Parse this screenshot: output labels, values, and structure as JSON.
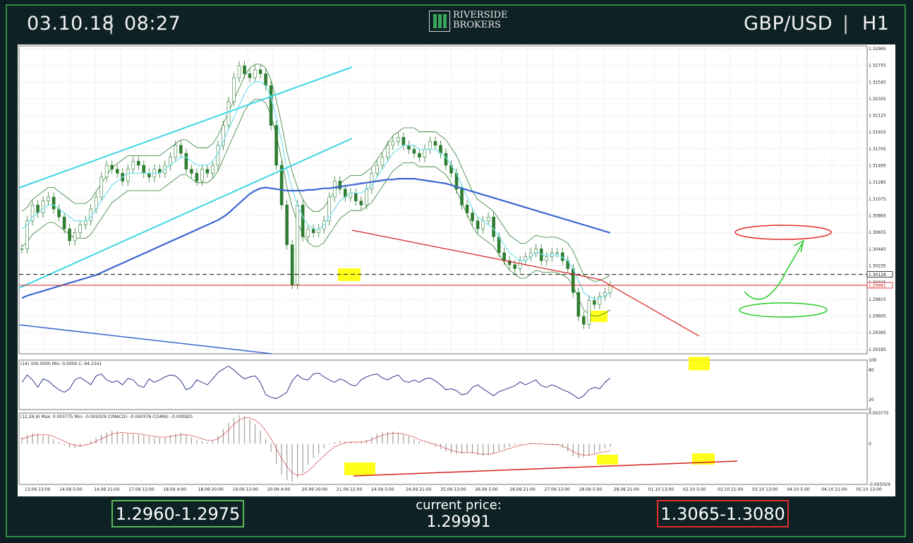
{
  "header": {
    "date": "03.10.18",
    "separator": "|",
    "time": "08:27",
    "pair": "GBP/USD",
    "timeframe": "H1"
  },
  "logo": {
    "line1": "RIVERSIDE",
    "line2": "BROKERS"
  },
  "footer": {
    "support_range": "1.2960-1.2975",
    "current_price_label": "current price:",
    "current_price": "1.29991",
    "resistance_range": "1.3065-1.3080"
  },
  "colors": {
    "background": "#0e2124",
    "frame": "#2f8a45",
    "support_box": "#5cb85c",
    "resistance_box": "#e52b2b",
    "price_candles": "#2e7d32",
    "bollinger": "#2e7d32",
    "ma_fast": "#7fe3ee",
    "ma_slow": "#3a66d0",
    "channel": "#3fd6e6",
    "trendline": "#d62020",
    "highlight": "#ffff00",
    "rsi_line": "#1a237e",
    "macd_hist": "#9e9e9e",
    "macd_signal": "#c62828"
  },
  "chart_data": {
    "type": "line",
    "main": {
      "y_ticks": [
        "1.32965",
        "1.32755",
        "1.32545",
        "1.32335",
        "1.32125",
        "1.31915",
        "1.31705",
        "1.31495",
        "1.31285",
        "1.31075",
        "1.30865",
        "1.30655",
        "1.30445",
        "1.30235",
        "1.30025",
        "1.29815",
        "1.29605",
        "1.29395",
        "1.29185"
      ],
      "y_range": [
        1.2913,
        1.33
      ],
      "marked_levels": [
        {
          "label": "1.30128",
          "value": 1.30128,
          "style": "dashed black"
        },
        {
          "label": "1.29991",
          "value": 1.29991,
          "style": "solid red"
        }
      ],
      "series": [
        {
          "values": [
            1.3045,
            1.308,
            1.31,
            1.309,
            1.3105,
            1.311,
            1.3095,
            1.3085,
            1.307,
            1.3055,
            1.3065,
            1.3075,
            1.308,
            1.3095,
            1.311,
            1.3135,
            1.315,
            1.3145,
            1.314,
            1.313,
            1.3145,
            1.3155,
            1.315,
            1.314,
            1.3135,
            1.3145,
            1.314,
            1.315,
            1.316,
            1.3175,
            1.3165,
            1.3145,
            1.314,
            1.313,
            1.3145,
            1.314,
            1.315,
            1.3175,
            1.32,
            1.323,
            1.326,
            1.3275,
            1.3265,
            1.326,
            1.327,
            1.3265,
            1.325,
            1.32,
            1.315,
            1.31,
            1.305,
            1.3,
            1.31,
            1.306,
            1.307,
            1.3065,
            1.307,
            1.308,
            1.311,
            1.313,
            1.312,
            1.311,
            1.3115,
            1.3105,
            1.31,
            1.312,
            1.314,
            1.315,
            1.316,
            1.3175,
            1.318,
            1.3185,
            1.3175,
            1.317,
            1.3165,
            1.316,
            1.317,
            1.318,
            1.3175,
            1.3165,
            1.315,
            1.314,
            1.312,
            1.31,
            1.309,
            1.308,
            1.307,
            1.308,
            1.3085,
            1.306,
            1.304,
            1.303,
            1.3025,
            1.302,
            1.303,
            1.3035,
            1.304,
            1.3045,
            1.303,
            1.3035,
            1.304,
            1.304,
            1.303,
            1.302,
            1.299,
            1.296,
            1.295,
            1.298,
            1.2975,
            1.2985,
            1.299,
            1.2999
          ]
        },
        {
          "values": [
            1.307,
            1.3075,
            1.3085,
            1.309,
            1.3095,
            1.31,
            1.31,
            1.3095,
            1.309,
            1.3085,
            1.308,
            1.308,
            1.308,
            1.3085,
            1.3095,
            1.3105,
            1.3115,
            1.3125,
            1.313,
            1.3135,
            1.314,
            1.314,
            1.314,
            1.314,
            1.314,
            1.314,
            1.314,
            1.3145,
            1.315,
            1.3155,
            1.316,
            1.316,
            1.3155,
            1.315,
            1.315,
            1.315,
            1.3155,
            1.3165,
            1.318,
            1.3195,
            1.321,
            1.3225,
            1.324,
            1.325,
            1.3255,
            1.3255,
            1.325,
            1.3235,
            1.321,
            1.318,
            1.3145,
            1.312,
            1.31,
            1.3085,
            1.3075,
            1.307,
            1.307,
            1.3075,
            1.3085,
            1.3095,
            1.3105,
            1.311,
            1.3115,
            1.3115,
            1.3115,
            1.312,
            1.3125,
            1.3135,
            1.3145,
            1.3155,
            1.3165,
            1.317,
            1.3175,
            1.3175,
            1.3175,
            1.317,
            1.317,
            1.317,
            1.317,
            1.3165,
            1.316,
            1.315,
            1.314,
            1.3125,
            1.311,
            1.3095,
            1.3085,
            1.308,
            1.3075,
            1.307,
            1.306,
            1.305,
            1.304,
            1.3035,
            1.303,
            1.303,
            1.3035,
            1.304,
            1.3038,
            1.3037,
            1.3038,
            1.3037,
            1.3034,
            1.303,
            1.302,
            1.3005,
            1.299,
            1.2985,
            1.2982,
            1.2983,
            1.2986,
            1.299
          ]
        },
        {
          "values": [
            1.2983,
            1.2986,
            1.2988,
            1.299,
            1.2992,
            1.2994,
            1.2996,
            1.2998,
            1.3,
            1.3002,
            1.3004,
            1.3006,
            1.3008,
            1.301,
            1.3012,
            1.3015,
            1.3018,
            1.3021,
            1.3024,
            1.3027,
            1.303,
            1.3033,
            1.3036,
            1.3039,
            1.3042,
            1.3045,
            1.3048,
            1.3051,
            1.3054,
            1.3057,
            1.306,
            1.3063,
            1.3066,
            1.3069,
            1.3072,
            1.3075,
            1.3078,
            1.3081,
            1.3085,
            1.309,
            1.3096,
            1.3102,
            1.3108,
            1.3114,
            1.3118,
            1.3121,
            1.3122,
            1.3121,
            1.312,
            1.3119,
            1.3118,
            1.3118,
            1.3118,
            1.3118,
            1.3119,
            1.3119,
            1.312,
            1.3121,
            1.3121,
            1.3122,
            1.3123,
            1.3124,
            1.3125,
            1.3126,
            1.3127,
            1.3128,
            1.3129,
            1.313,
            1.3131,
            1.3132,
            1.3132,
            1.3133,
            1.3133,
            1.3133,
            1.3133,
            1.3132,
            1.3131,
            1.313,
            1.3129,
            1.3128,
            1.3127,
            1.3125,
            1.3123,
            1.3121,
            1.3119,
            1.3117,
            1.3115,
            1.3113,
            1.3111,
            1.3109,
            1.3107,
            1.3105,
            1.3103,
            1.3101,
            1.3099,
            1.3097,
            1.3095,
            1.3093,
            1.3091,
            1.3089,
            1.3087,
            1.3085,
            1.3083,
            1.3081,
            1.3079,
            1.3077,
            1.3075,
            1.3073,
            1.3071,
            1.3069,
            1.3067,
            1.3065
          ]
        }
      ]
    },
    "rsi": {
      "header": "(14) 100.0000 Min: 0.0000 C: 64.1541",
      "y_ticks": [
        "100",
        "80",
        "20",
        "0"
      ],
      "y_range": [
        0,
        100
      ],
      "values": [
        55,
        70,
        60,
        45,
        62,
        58,
        48,
        40,
        35,
        42,
        60,
        65,
        58,
        50,
        68,
        72,
        60,
        55,
        58,
        50,
        63,
        60,
        48,
        45,
        62,
        55,
        60,
        66,
        70,
        68,
        58,
        40,
        45,
        60,
        55,
        50,
        62,
        75,
        82,
        88,
        80,
        70,
        62,
        66,
        68,
        55,
        30,
        25,
        22,
        28,
        35,
        58,
        70,
        62,
        60,
        72,
        74,
        66,
        60,
        55,
        62,
        58,
        50,
        48,
        60,
        66,
        70,
        72,
        64,
        60,
        66,
        70,
        58,
        55,
        60,
        55,
        62,
        64,
        58,
        50,
        40,
        42,
        38,
        30,
        32,
        45,
        50,
        42,
        35,
        28,
        36,
        40,
        44,
        48,
        56,
        50,
        55,
        60,
        48,
        45,
        50,
        46,
        40,
        36,
        30,
        22,
        28,
        40,
        45,
        42,
        55,
        64
      ]
    },
    "macd": {
      "header": "(12,26,9) Max: 0.003775 Min: -0.005029 C(MACD): -0.000376 C(SMA): -0.000920",
      "y_ticks": [
        "0.003775",
        "0",
        "-0.005029"
      ],
      "y_range": [
        -0.005029,
        0.003775
      ],
      "histogram": [
        0.0008,
        0.0011,
        0.0013,
        0.0012,
        0.0011,
        0.001,
        0.0006,
        0.0002,
        -0.0002,
        -0.0005,
        -0.0006,
        -0.0004,
        -0.0001,
        0.0003,
        0.0007,
        0.0011,
        0.0014,
        0.0016,
        0.0015,
        0.0013,
        0.0012,
        0.0012,
        0.0011,
        0.001,
        0.0009,
        0.0008,
        0.0007,
        0.0008,
        0.001,
        0.0012,
        0.0013,
        0.0011,
        0.0008,
        0.0005,
        0.0003,
        0.0002,
        0.0004,
        0.001,
        0.0018,
        0.0026,
        0.0032,
        0.0035,
        0.0034,
        0.003,
        0.0024,
        0.0016,
        0.0006,
        -0.001,
        -0.0025,
        -0.0038,
        -0.0045,
        -0.0047,
        -0.0042,
        -0.0036,
        -0.0026,
        -0.0018,
        -0.0012,
        -0.0006,
        -0.0001,
        0.0002,
        0.0003,
        0.0003,
        0.0002,
        0.0001,
        0.0002,
        0.0005,
        0.0009,
        0.0012,
        0.0014,
        0.0015,
        0.0015,
        0.0013,
        0.0011,
        0.0009,
        0.0006,
        0.0003,
        0.0001,
        -0.0001,
        -0.0004,
        -0.0007,
        -0.001,
        -0.0012,
        -0.0013,
        -0.0012,
        -0.0011,
        -0.0012,
        -0.0014,
        -0.0015,
        -0.0014,
        -0.0012,
        -0.0009,
        -0.0006,
        -0.0004,
        -0.0002,
        -0.0001,
        0.0,
        0.0001,
        0.0,
        -0.0001,
        -0.0001,
        -0.0001,
        -0.0002,
        -0.0005,
        -0.001,
        -0.0016,
        -0.0018,
        -0.0017,
        -0.0015,
        -0.0012,
        -0.0009,
        -0.0006,
        -0.0004
      ],
      "signal": [
        0.0006,
        0.0008,
        0.001,
        0.0011,
        0.0011,
        0.0011,
        0.0009,
        0.0006,
        0.0003,
        0.0,
        -0.0002,
        -0.0003,
        -0.0002,
        0.0,
        0.0003,
        0.0006,
        0.0009,
        0.0012,
        0.0013,
        0.0014,
        0.0013,
        0.0013,
        0.0012,
        0.0011,
        0.001,
        0.0009,
        0.0008,
        0.0008,
        0.0009,
        0.001,
        0.0011,
        0.0011,
        0.001,
        0.0008,
        0.0006,
        0.0004,
        0.0004,
        0.0006,
        0.0011,
        0.0017,
        0.0024,
        0.0029,
        0.0032,
        0.0032,
        0.0029,
        0.0024,
        0.0016,
        0.0006,
        -0.0006,
        -0.0018,
        -0.0028,
        -0.0036,
        -0.0039,
        -0.0038,
        -0.0034,
        -0.0028,
        -0.0021,
        -0.0015,
        -0.0009,
        -0.0004,
        -0.0001,
        0.0001,
        0.0002,
        0.0002,
        0.0002,
        0.0003,
        0.0005,
        0.0008,
        0.001,
        0.0012,
        0.0013,
        0.0013,
        0.0012,
        0.001,
        0.0008,
        0.0005,
        0.0003,
        0.0001,
        -0.0001,
        -0.0003,
        -0.0006,
        -0.0008,
        -0.001,
        -0.0011,
        -0.0011,
        -0.0011,
        -0.0012,
        -0.0013,
        -0.0013,
        -0.0012,
        -0.001,
        -0.0008,
        -0.0006,
        -0.0004,
        -0.0002,
        -0.0001,
        0.0,
        0.0,
        0.0,
        -0.0001,
        -0.0001,
        -0.0001,
        -0.0003,
        -0.0006,
        -0.001,
        -0.0013,
        -0.0014,
        -0.0014,
        -0.0013,
        -0.0011,
        -0.001,
        -0.0009
      ]
    },
    "x_labels": [
      "13.09 13:00",
      "14.09 5:00",
      "14.09 21:00",
      "17.09 12:00",
      "18.09 4:00",
      "18.09 20:00",
      "19.09 12:00",
      "20.09 4:00",
      "20.09 20:00",
      "21.09 12:00",
      "24.09 5:00",
      "24.09 21:00",
      "25.09 13:00",
      "26.09 5:00",
      "26.09 21:00",
      "27.09 13:00",
      "28.09 5:00",
      "28.09 21:00",
      "01.10 13:00",
      "02.10 5:00",
      "02.10 21:00",
      "03.10 13:00",
      "04.10 5:00",
      "04.10 21:00",
      "05.10 13:00"
    ]
  }
}
